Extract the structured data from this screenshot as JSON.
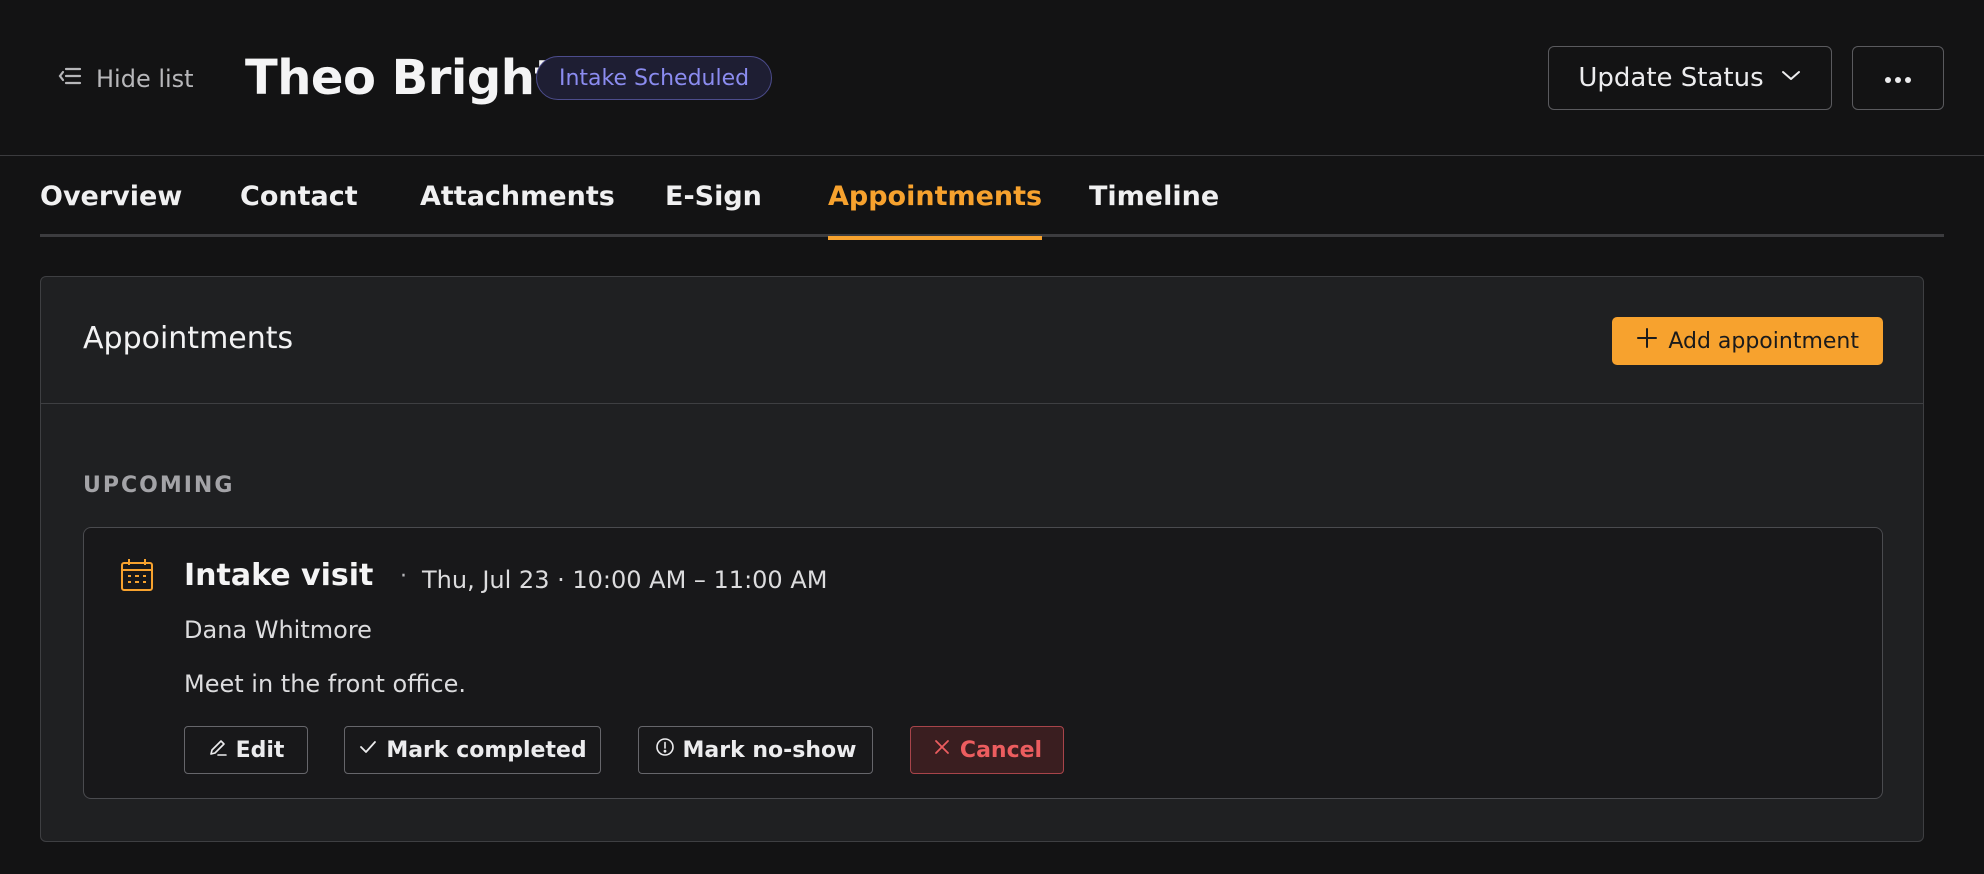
{
  "header": {
    "hide_list_label": "Hide list",
    "person_name": "Theo Bright",
    "status_badge": "Intake Scheduled",
    "update_status_label": "Update Status"
  },
  "tabs": [
    {
      "label": "Overview",
      "active": false
    },
    {
      "label": "Contact",
      "active": false
    },
    {
      "label": "Attachments",
      "active": false
    },
    {
      "label": "E-Sign",
      "active": false
    },
    {
      "label": "Appointments",
      "active": true
    },
    {
      "label": "Timeline",
      "active": false
    }
  ],
  "appointments_panel": {
    "title": "Appointments",
    "add_button_label": "Add appointment",
    "section_label": "UPCOMING",
    "items": [
      {
        "title": "Intake visit",
        "separator": "·",
        "when": "Thu, Jul 23 · 10:00 AM – 11:00 AM",
        "person": "Dana Whitmore",
        "note": "Meet in the front office.",
        "actions": {
          "edit": "Edit",
          "mark_completed": "Mark completed",
          "mark_no_show": "Mark no-show",
          "cancel": "Cancel"
        }
      }
    ]
  },
  "colors": {
    "accent": "#f7a22e",
    "badge_text": "#8b8cf0",
    "danger": "#ec5d5f",
    "background": "#131314",
    "card": "#1f2022"
  },
  "icons": {
    "hide_list": "list-collapse-icon",
    "update_status": "chevron-down-icon",
    "more": "ellipsis-icon",
    "add": "plus-icon",
    "appointment": "calendar-icon",
    "edit": "pencil-icon",
    "completed": "check-icon",
    "no_show": "alert-circle-icon",
    "cancel": "x-icon"
  }
}
